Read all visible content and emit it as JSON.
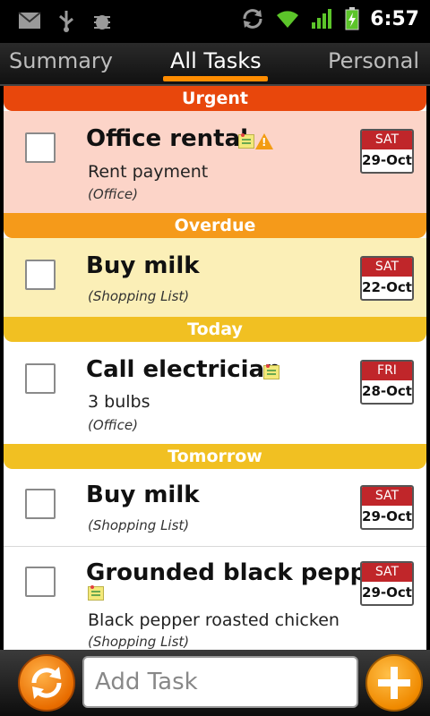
{
  "status_bar": {
    "time": "6:57",
    "icons": [
      "mail-icon",
      "usb-icon",
      "debug-icon",
      "sync-icon",
      "wifi-icon",
      "signal-icon",
      "battery-charging-icon"
    ]
  },
  "tabs": [
    {
      "label": "Summary",
      "active": false
    },
    {
      "label": "All Tasks",
      "active": true
    },
    {
      "label": "Personal",
      "active": false
    }
  ],
  "sections": {
    "urgent": {
      "label": "Urgent",
      "color": "#e8470c"
    },
    "overdue": {
      "label": "Overdue",
      "color": "#f59a1a"
    },
    "today": {
      "label": "Today",
      "color": "#f1c022"
    },
    "tomorrow": {
      "label": "Tomorrow",
      "color": "#f1c022"
    }
  },
  "tasks": [
    {
      "title": "Office rental",
      "note": "Rent payment",
      "list": "(Office)",
      "day": "SAT",
      "date": "29-Oct",
      "bg": "#fcd4c8",
      "icons": [
        "note-icon",
        "warning-icon"
      ]
    },
    {
      "title": "Buy milk",
      "note": "",
      "list": "(Shopping List)",
      "day": "SAT",
      "date": "22-Oct",
      "bg": "#fbefb7",
      "icons": []
    },
    {
      "title": "Call electrician",
      "note": "3 bulbs",
      "list": "(Office)",
      "day": "FRI",
      "date": "28-Oct",
      "bg": "#ffffff",
      "icons": [
        "note-icon"
      ]
    },
    {
      "title": "Buy milk",
      "note": "",
      "list": "(Shopping List)",
      "day": "SAT",
      "date": "29-Oct",
      "bg": "#ffffff",
      "icons": []
    },
    {
      "title": "Grounded black pepper",
      "note": "Black pepper roasted chicken",
      "list": "(Shopping List)",
      "day": "SAT",
      "date": "29-Oct",
      "bg": "#ffffff",
      "icons": [
        "note-icon"
      ]
    }
  ],
  "bottom_bar": {
    "add_placeholder": "Add Task",
    "refresh_icon": "refresh-icon",
    "add_icon": "plus-icon"
  }
}
